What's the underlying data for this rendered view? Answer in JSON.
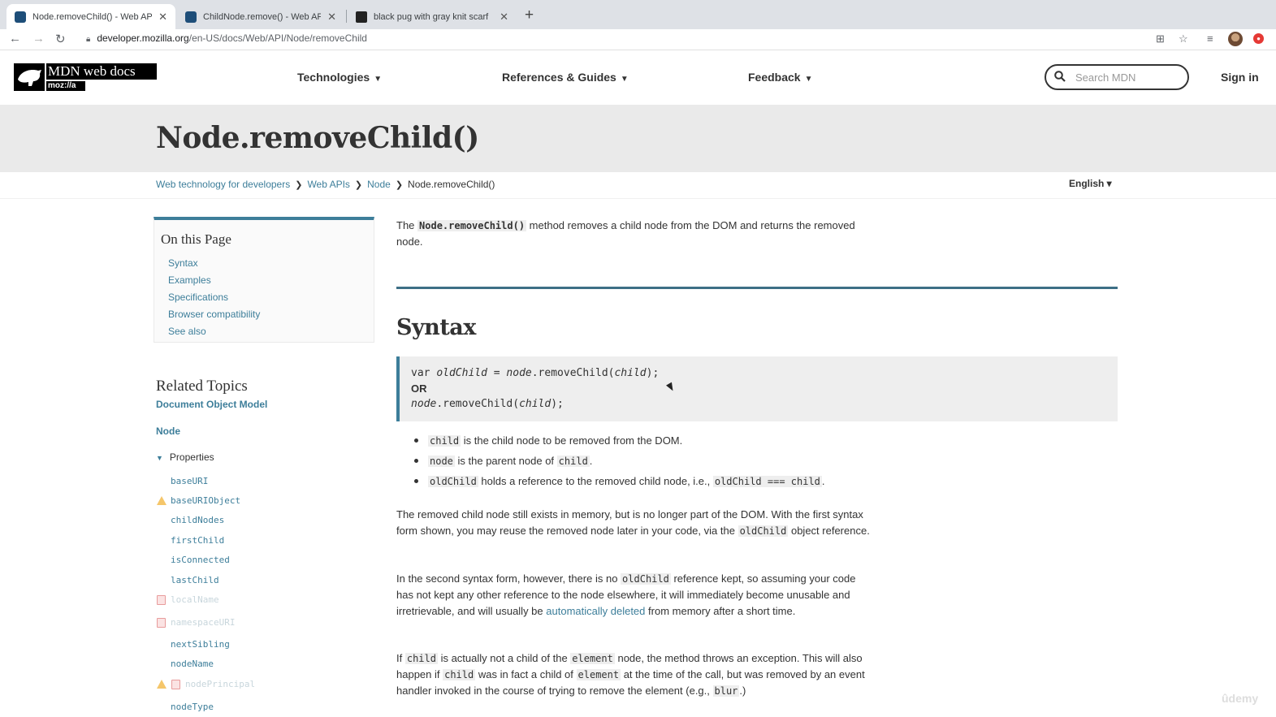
{
  "browser": {
    "tabs": [
      {
        "title": "Node.removeChild() - Web API"
      },
      {
        "title": "ChildNode.remove() - Web API"
      },
      {
        "title": "black pug with gray knit scarf"
      }
    ],
    "new_tab": "+",
    "url_host": "developer.mozilla.org",
    "url_path": "/en-US/docs/Web/API/Node/removeChild"
  },
  "header": {
    "logo_text": "MDN web docs",
    "logo_sub": "moz://a",
    "nav": [
      "Technologies",
      "References & Guides",
      "Feedback"
    ],
    "search_placeholder": "Search MDN",
    "signin": "Sign in"
  },
  "page": {
    "title": "Node.removeChild()",
    "breadcrumbs": [
      "Web technology for developers",
      "Web APIs",
      "Node",
      "Node.removeChild()"
    ],
    "language": "English ▾"
  },
  "toc": {
    "heading": "On this Page",
    "items": [
      "Syntax",
      "Examples",
      "Specifications",
      "Browser compatibility",
      "See also"
    ]
  },
  "related": {
    "heading": "Related Topics",
    "dom": "Document Object Model",
    "node": "Node",
    "properties_label": "Properties",
    "properties": [
      "baseURI",
      "baseURIObject",
      "childNodes",
      "firstChild",
      "isConnected",
      "lastChild",
      "localName",
      "namespaceURI",
      "nextSibling",
      "nodeName",
      "nodePrincipal",
      "nodeType"
    ]
  },
  "content": {
    "intro_pre": "The ",
    "intro_code": "Node.removeChild()",
    "intro_post": " method removes a child node from the DOM and returns the removed node.",
    "syntax_heading": "Syntax",
    "code_line1_a": "var ",
    "code_line1_b": "oldChild",
    "code_line1_c": " = ",
    "code_line1_d": "node",
    "code_line1_e": ".removeChild(",
    "code_line1_f": "child",
    "code_line1_g": ");",
    "code_or": "OR",
    "code_line2_a": "node",
    "code_line2_b": ".removeChild(",
    "code_line2_c": "child",
    "code_line2_d": ");",
    "b1_code": "child",
    "b1_text": " is the child node to be removed from the DOM.",
    "b2_code": "node",
    "b2_text": " is the parent node of ",
    "b2_code2": "child",
    "b2_end": ".",
    "b3_code": "oldChild",
    "b3_text": " holds a reference to the removed child node, i.e., ",
    "b3_code2": "oldChild === child",
    "b3_end": ".",
    "p1_a": "The removed child node still exists in memory, but is no longer part of the DOM. With the first syntax form shown, you may reuse the removed node later in your code, via the ",
    "p1_code": "oldChild",
    "p1_b": " object reference.",
    "p2_a": "In the second syntax form, however, there is no ",
    "p2_code": "oldChild",
    "p2_b": " reference kept, so assuming your code has not kept any other reference to the node elsewhere, it will immediately become unusable and irretrievable, and will usually be ",
    "p2_link": "automatically deleted",
    "p2_c": " from memory after a short time.",
    "p3_a": "If ",
    "p3_code1": "child",
    "p3_b": " is actually not a child of the ",
    "p3_code2": "element",
    "p3_c": " node, the method throws an exception. This will also happen if ",
    "p3_code3": "child",
    "p3_d": " was in fact a child of ",
    "p3_code4": "element",
    "p3_e": " at the time of the call, but was removed by an event handler invoked in the course of trying to remove the element (e.g., ",
    "p3_code5": "blur",
    "p3_f": ".)"
  },
  "watermark": "ûdemy",
  "colors": {
    "accent": "#3d7e9a",
    "title_band": "#eaeaea"
  }
}
